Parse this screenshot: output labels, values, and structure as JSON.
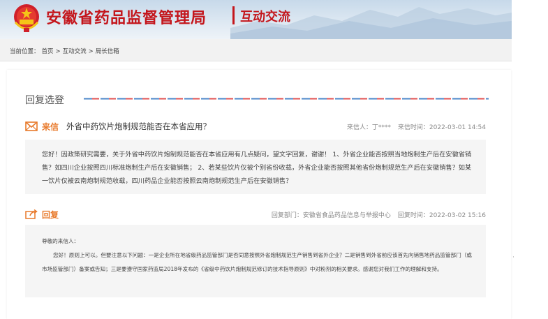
{
  "header": {
    "site_name": "安徽省药品监督管理局",
    "section": "互动交流"
  },
  "breadcrumb": {
    "prefix": "当前位置：",
    "items": [
      "首页",
      "互动交流",
      "局长信箱"
    ],
    "separator": ">"
  },
  "page": {
    "title": "回复选登"
  },
  "letter": {
    "tag": "来信",
    "subject": "外省中药饮片炮制规范能否在本省应用？",
    "sender_label": "来信人：丁****",
    "time_label": "来信时间：2022-03-01 14:54",
    "body": "您好！因政策研究需要，关于外省中药饮片炮制规范能否在本省应用有几点疑问，望文字回复，谢谢！ 1、外省企业能否按照当地炮制生产后在安徽省销售？如四川企业按照四川标准炮制生产后在安徽销售； 2、若某些饮片仅被个别省份收载，外省企业能否按照其他省份炮制规范生产后在安徽销售？如某一饮片仅被云南炮制规范收载，四川药品企业能否按照云南炮制规范生产后在安徽销售？"
  },
  "reply": {
    "tag": "回复",
    "dept_label": "回复部门：安徽省食品药品信息与举报中心",
    "time_label": "回复时间：2022-03-02 15:16",
    "greeting": "尊敬的来信人：",
    "body": "您好！原则上可以。但要注意以下问题：一是企业所在地省级药品监管部门是否同意按照外省炮制规范生产销售到省外企业？二是销售到外省前应该首先向销售地药品监管部门（或市场监管部门）备案或告知；三是要遵守国家药监局2018年发布的《省级中药饮片炮制规范修订的技术指导原则》中对粉剂的相关要求。感谢您对我们工作的理解和支持。"
  },
  "icons": {
    "emblem": "national-emblem-icon",
    "letter": "envelope-icon",
    "reply": "reply-arrow-icon"
  },
  "colors": {
    "brand_red": "#c4161c",
    "accent_orange": "#e8792a",
    "dash_red": "#e05050",
    "dash_blue": "#4a86c8"
  }
}
